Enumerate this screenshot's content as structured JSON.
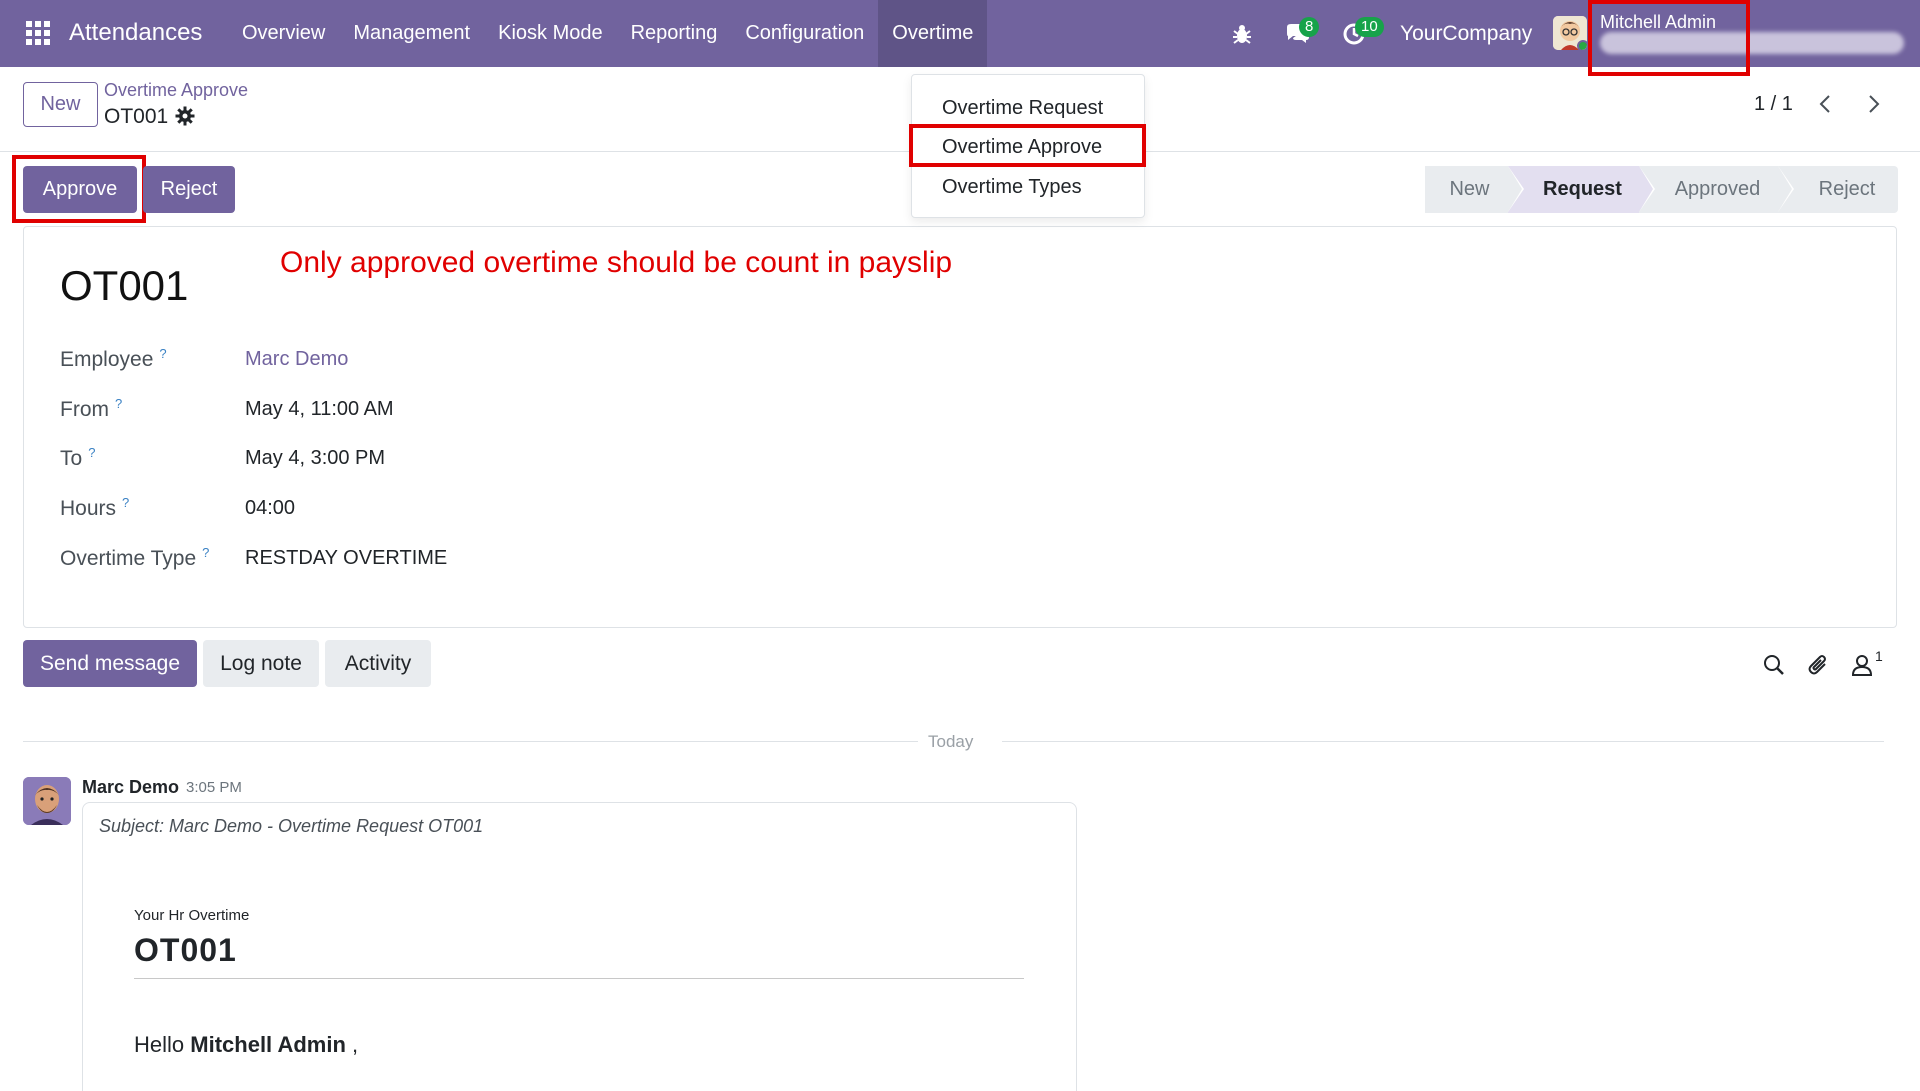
{
  "navbar": {
    "brand": "Attendances",
    "menu": [
      "Overview",
      "Management",
      "Kiosk Mode",
      "Reporting",
      "Configuration",
      "Overtime"
    ],
    "active_menu": "Overtime",
    "messages_badge": "8",
    "activities_badge": "10",
    "company": "YourCompany",
    "user_name": "Mitchell Admin",
    "accent_color": "#71639e"
  },
  "control_panel": {
    "new_button": "New",
    "breadcrumb_parent": "Overtime Approve",
    "record_name": "OT001",
    "pager": "1 / 1"
  },
  "overtime_menu": {
    "items": [
      "Overtime Request",
      "Overtime Approve",
      "Overtime Types"
    ],
    "highlighted": "Overtime Approve"
  },
  "actions": {
    "approve": "Approve",
    "reject": "Reject"
  },
  "statusbar": {
    "stages": [
      "New",
      "Request",
      "Approved",
      "Reject"
    ],
    "current": "Request"
  },
  "form": {
    "title": "OT001",
    "annotation": "Only approved overtime should be count in payslip",
    "help_marker": "?",
    "fields": [
      {
        "label": "Employee",
        "value": "Marc Demo"
      },
      {
        "label": "From",
        "value": "May 4, 11:00 AM"
      },
      {
        "label": "To",
        "value": "May 4, 3:00 PM"
      },
      {
        "label": "Hours",
        "value": "04:00"
      },
      {
        "label": "Overtime Type",
        "value": "RESTDAY OVERTIME"
      }
    ]
  },
  "chatter": {
    "send_message": "Send message",
    "log_note": "Log note",
    "activity": "Activity",
    "followers_count": "1",
    "date_separator": "Today",
    "message": {
      "author": "Marc Demo",
      "time": "3:05 PM",
      "subject": "Subject: Marc Demo - Overtime Request OT001",
      "mail_heading_small": "Your Hr Overtime",
      "mail_title": "OT001",
      "hello_prefix": "Hello",
      "hello_name": "Mitchell Admin",
      "hello_suffix": ","
    }
  }
}
